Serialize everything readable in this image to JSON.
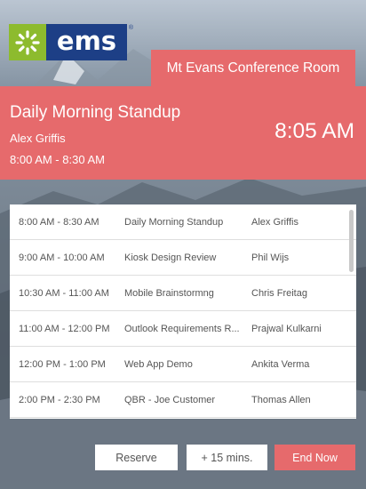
{
  "logo": {
    "text": "ems",
    "trademark": "®",
    "brand_green": "#8dbb2e",
    "brand_blue": "#1d3f86"
  },
  "room": {
    "name": "Mt Evans Conference Room"
  },
  "current_meeting": {
    "title": "Daily Morning Standup",
    "host": "Alex Griffis",
    "time_range": "8:00 AM - 8:30 AM",
    "clock": "8:05 AM"
  },
  "schedule": [
    {
      "time": "8:00 AM - 8:30 AM",
      "title": "Daily Morning Standup",
      "host": "Alex Griffis"
    },
    {
      "time": "9:00 AM - 10:00 AM",
      "title": "Kiosk Design Review",
      "host": "Phil Wijs"
    },
    {
      "time": "10:30 AM - 11:00 AM",
      "title": "Mobile Brainstormng",
      "host": "Chris Freitag"
    },
    {
      "time": "11:00 AM - 12:00 PM",
      "title": "Outlook Requirements R...",
      "host": "Prajwal Kulkarni"
    },
    {
      "time": "12:00 PM - 1:00 PM",
      "title": "Web App Demo",
      "host": "Ankita Verma"
    },
    {
      "time": "2:00 PM - 2:30 PM",
      "title": "QBR - Joe Customer",
      "host": "Thomas Allen"
    }
  ],
  "actions": {
    "reserve": "Reserve",
    "extend": "+ 15 mins.",
    "end": "End Now"
  },
  "colors": {
    "accent": "#e66a6c",
    "panel": "#ffffff"
  }
}
